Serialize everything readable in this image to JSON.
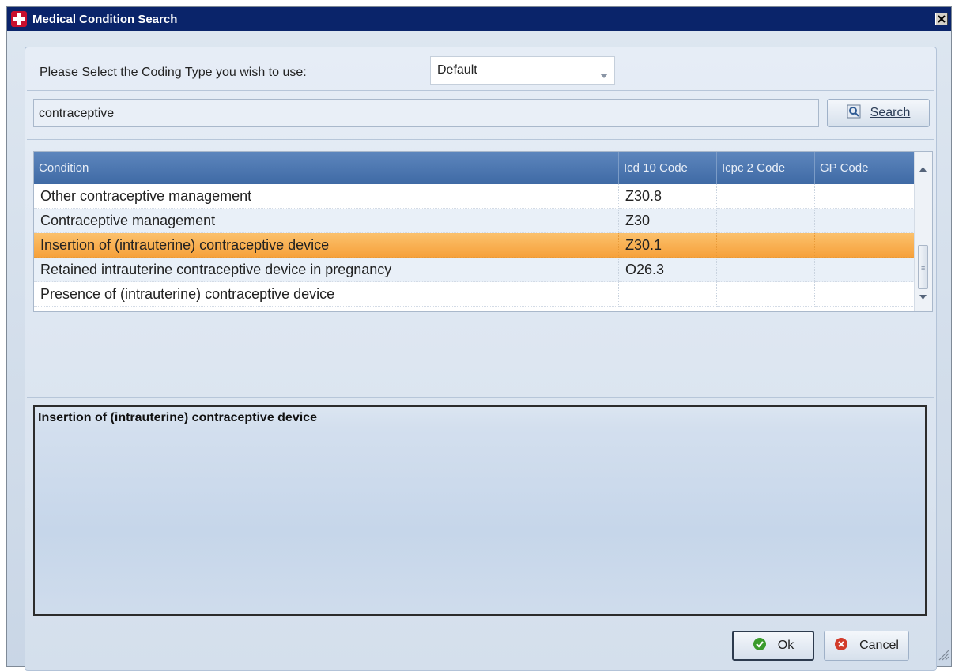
{
  "window": {
    "title": "Medical Condition Search"
  },
  "coding": {
    "label": "Please Select the Coding Type you wish to use:",
    "selected": "Default"
  },
  "search": {
    "value": "contraceptive",
    "button_label": "Search"
  },
  "grid": {
    "columns": [
      "Condition",
      "Icd 10 Code",
      "Icpc 2 Code",
      "GP Code"
    ],
    "rows": [
      {
        "condition": "Other contraceptive management",
        "icd10": "Z30.8",
        "icpc2": "",
        "gp": ""
      },
      {
        "condition": "Contraceptive management",
        "icd10": "Z30",
        "icpc2": "",
        "gp": ""
      },
      {
        "condition": "Insertion of (intrauterine) contraceptive device",
        "icd10": "Z30.1",
        "icpc2": "",
        "gp": ""
      },
      {
        "condition": "Retained intrauterine contraceptive device in pregnancy",
        "icd10": "O26.3",
        "icpc2": "",
        "gp": ""
      },
      {
        "condition": "Presence of (intrauterine) contraceptive device",
        "icd10": "",
        "icpc2": "",
        "gp": ""
      }
    ],
    "selected_index": 2
  },
  "description": {
    "text": "Insertion of (intrauterine) contraceptive device"
  },
  "buttons": {
    "ok": "Ok",
    "cancel": "Cancel"
  },
  "icons": {
    "app": "medical-cross-icon",
    "close": "close-icon",
    "search": "magnifier-icon",
    "ok": "green-check-icon",
    "cancel": "red-x-icon"
  },
  "colors": {
    "title_bar": "#0a246a",
    "header": "#4a74ae",
    "selection": "#f6a03a"
  }
}
